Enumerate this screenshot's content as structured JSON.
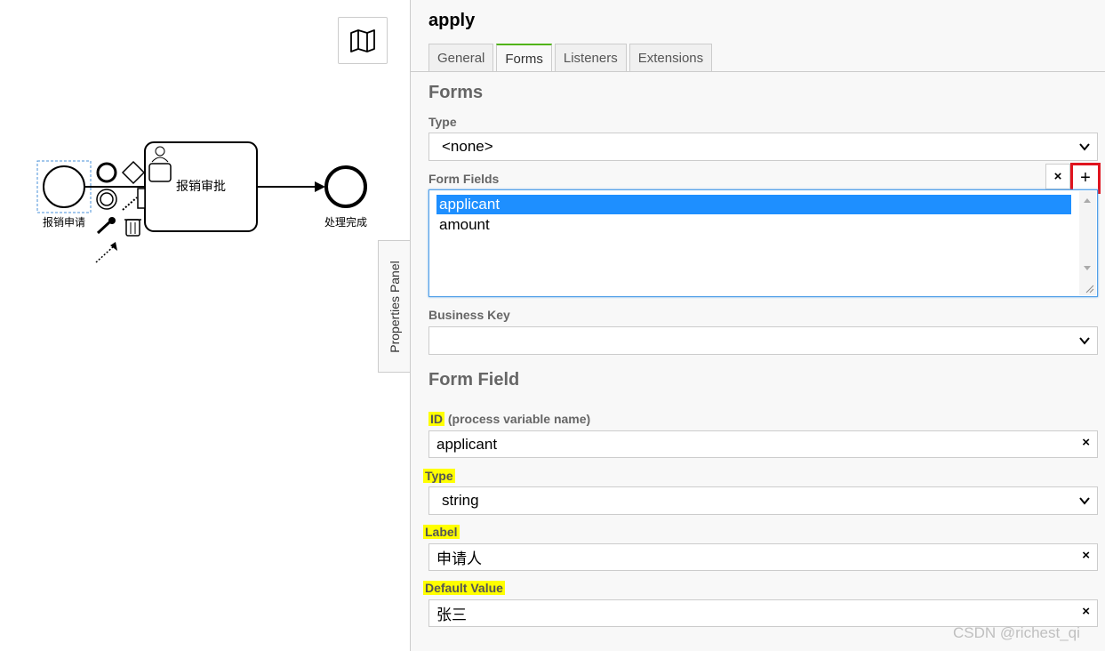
{
  "canvas": {
    "start_event_label": "报销申请",
    "task_label": "报销审批",
    "end_event_label": "处理完成",
    "minimap_icon": "map-icon"
  },
  "panel_toggle": {
    "label": "Properties Panel"
  },
  "panel": {
    "title": "apply",
    "tabs": [
      {
        "label": "General",
        "active": false
      },
      {
        "label": "Forms",
        "active": true
      },
      {
        "label": "Listeners",
        "active": false
      },
      {
        "label": "Extensions",
        "active": false
      }
    ],
    "forms_section": {
      "title": "Forms",
      "type_label": "Type",
      "type_value": "<none>",
      "form_fields_label": "Form Fields",
      "remove_label": "×",
      "add_label": "+",
      "form_fields": [
        "applicant",
        "amount"
      ],
      "selected_field": "applicant",
      "business_key_label": "Business Key",
      "business_key_value": ""
    },
    "form_field_section": {
      "title": "Form Field",
      "id_label": "ID",
      "id_sublabel": "(process variable name)",
      "id_value": "applicant",
      "type_label": "Type",
      "type_value": "string",
      "label_label": "Label",
      "label_value": "申请人",
      "default_label": "Default Value",
      "default_value": "张三",
      "clear_label": "×"
    },
    "highlight_color": "#ffff00",
    "add_button_border_color": "#e0141e",
    "selection_color": "#1e8fff"
  },
  "watermark": "CSDN @richest_qi"
}
